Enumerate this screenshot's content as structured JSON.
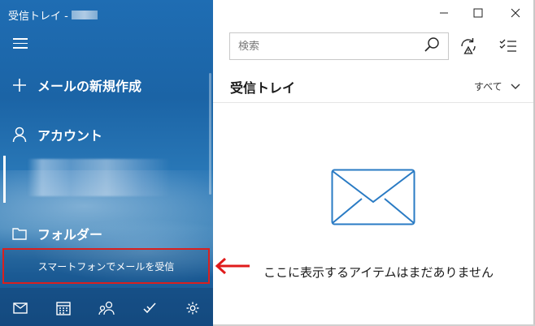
{
  "window": {
    "title": "受信トレイ - "
  },
  "sidebar": {
    "new_mail": "メールの新規作成",
    "account": "アカウント",
    "folder": "フォルダー",
    "smartphone_link": "スマートフォンでメールを受信"
  },
  "search": {
    "placeholder": "検索"
  },
  "inbox": {
    "title": "受信トレイ",
    "filter": "すべて",
    "empty_message": "ここに表示するアイテムはまだありません"
  },
  "colors": {
    "sidebar_blue": "#1b64a6",
    "highlight_red": "#d9201f",
    "accent_envelope": "#2a7bc4"
  },
  "icons": {
    "mail": "mail-icon",
    "calendar": "calendar-icon",
    "people": "people-icon",
    "todo": "todo-icon",
    "settings": "gear-icon"
  }
}
